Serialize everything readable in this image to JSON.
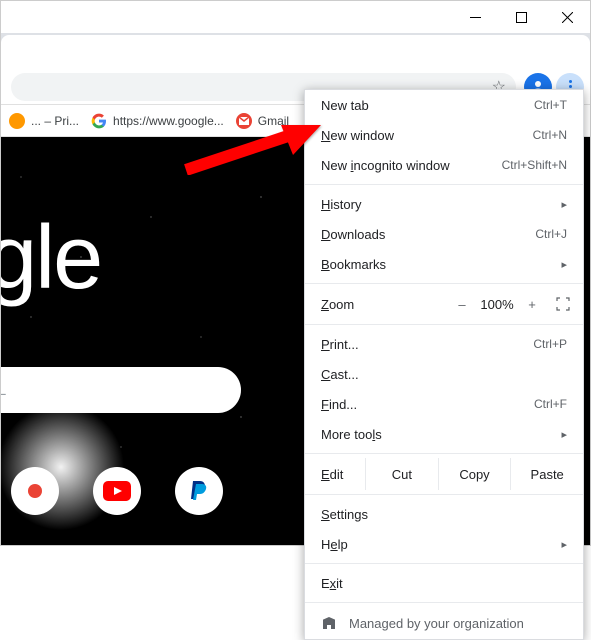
{
  "titlebar": {},
  "bookmarks": {
    "item1": "... – Pri...",
    "item2": "https://www.google...",
    "item3": "Gmail"
  },
  "page": {
    "logo": "oogle",
    "search_placeholder": "RL"
  },
  "menu": {
    "new_tab": "New tab",
    "new_tab_kb": "Ctrl+T",
    "new_window": "New window",
    "new_window_kb": "Ctrl+N",
    "incognito": "New incognito window",
    "incognito_kb": "Ctrl+Shift+N",
    "history": "History",
    "downloads": "Downloads",
    "downloads_kb": "Ctrl+J",
    "bookmarks": "Bookmarks",
    "zoom": "Zoom",
    "zoom_minus": "–",
    "zoom_val": "100%",
    "zoom_plus": "+",
    "print": "Print...",
    "print_kb": "Ctrl+P",
    "cast": "Cast...",
    "find": "Find...",
    "find_kb": "Ctrl+F",
    "more_tools": "More tools",
    "edit": "Edit",
    "cut": "Cut",
    "copy": "Copy",
    "paste": "Paste",
    "settings": "Settings",
    "help": "Help",
    "exit": "Exit",
    "managed": "Managed by your organization"
  }
}
